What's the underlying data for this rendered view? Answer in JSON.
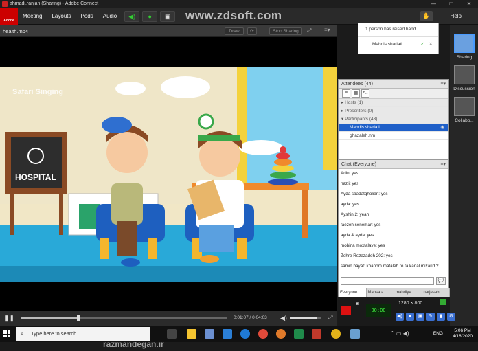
{
  "window": {
    "title": "ahmadi.ranjan (Sharing) - Adobe Connect"
  },
  "menu": {
    "logo_text": "Adobe",
    "items": [
      "Meeting",
      "Layouts",
      "Pods",
      "Audio"
    ],
    "help": "Help"
  },
  "watermark": "www.zdsoft.com",
  "share_pod": {
    "title": "health.mp4",
    "draw_label": "Draw",
    "stop_label": "Stop Sharing",
    "current_time": "0:01:07",
    "total_time": "0:04:03",
    "progress": 0.28,
    "volume": 0.85,
    "video_logo": "Safari Singing",
    "hospital_sign": "HOSPITAL"
  },
  "overlay_watermark": "razmandegan.ir",
  "notification": {
    "text": "1 person has raised hand.",
    "name": "Mahdis shariati",
    "accept": "✓",
    "dismiss": "✕"
  },
  "attendees": {
    "title": "Attendees",
    "count": "(44)",
    "groups": [
      {
        "label": "Hosts (1)"
      },
      {
        "label": "Presenters (0)"
      },
      {
        "label": "Participants (43)"
      }
    ],
    "users": [
      "Mahdis shariati",
      "ghazaleh.nm"
    ]
  },
  "chat": {
    "title": "Chat",
    "scope": "(Everyone)",
    "messages": [
      "Adin: yes",
      "nazli: yes",
      "Ayda saadatgholian: yes",
      "ayda: yes",
      "Ayshin 2: yeah",
      "faezeh senemar: yes",
      "ayda & ayda: yes",
      "mobina moxtalave: yes",
      "Zohre Rezazadeh 202: yes",
      "samin bayat: khanom mataleb ro ta kanal mizarid ?"
    ],
    "tabs": [
      "Everyone",
      "Mahsa a...",
      "mahdiye...",
      "narjesab..."
    ]
  },
  "layouts": [
    {
      "label": "Sharing"
    },
    {
      "label": "Discussion"
    },
    {
      "label": "Collabo..."
    }
  ],
  "recorder": {
    "lcd": "00:00",
    "resolution": "1280 × 800"
  },
  "taskbar": {
    "search_placeholder": "Type here to search",
    "language": "ENG",
    "time": "5:06 PM",
    "date": "4/18/2020"
  },
  "colors": {
    "accent": "#1e5fc8",
    "record": "#dd1111",
    "brand": "#cc0000"
  }
}
